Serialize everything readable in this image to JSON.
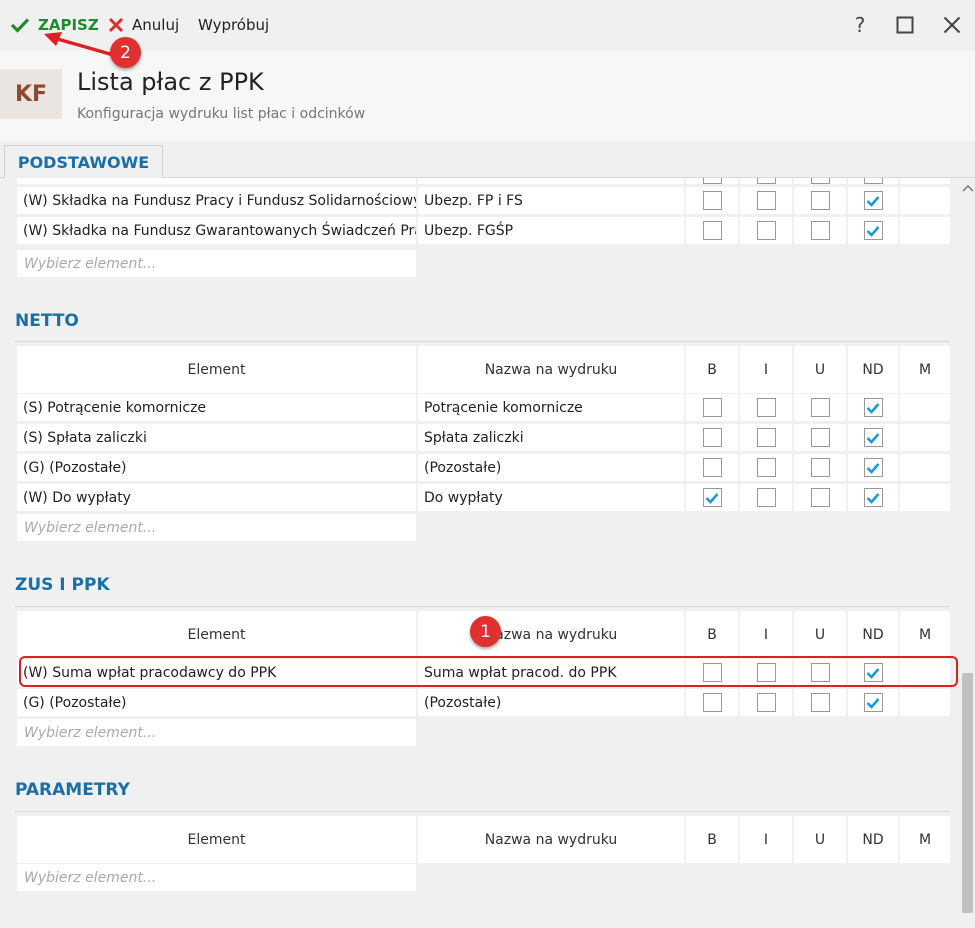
{
  "toolbar": {
    "save_label": "ZAPISZ",
    "cancel_label": "Anuluj",
    "try_label": "Wypróbuj",
    "help_label": "?"
  },
  "header": {
    "logo": "KF",
    "title": "Lista płac z PPK",
    "subtitle": "Konfiguracja wydruku list płac i odcinków"
  },
  "tabs": [
    {
      "label": "PODSTAWOWE",
      "active": true
    }
  ],
  "columns": {
    "element": "Element",
    "print_name": "Nazwa na wydruku",
    "b": "B",
    "i": "I",
    "u": "U",
    "nd": "ND",
    "m": "M"
  },
  "placeholder": "Wybierz element...",
  "section_podstawowe": {
    "rows": [
      {
        "element": "(W) Składka na Fundusz Pracy i Fundusz Solidarnościowy",
        "print_name": "Ubezp. FP i FS",
        "b": false,
        "i": false,
        "u": false,
        "nd": true
      },
      {
        "element": "(W) Składka na Fundusz Gwarantowanych Świadczeń Pracowniczych",
        "print_name": "Ubezp. FGŚP",
        "b": false,
        "i": false,
        "u": false,
        "nd": true
      }
    ]
  },
  "section_netto": {
    "title": "NETTO",
    "rows": [
      {
        "element": "(S) Potrącenie komornicze",
        "print_name": "Potrącenie komornicze",
        "b": false,
        "i": false,
        "u": false,
        "nd": true
      },
      {
        "element": "(S) Spłata zaliczki",
        "print_name": "Spłata zaliczki",
        "b": false,
        "i": false,
        "u": false,
        "nd": true
      },
      {
        "element": "(G) (Pozostałe)",
        "print_name": "(Pozostałe)",
        "b": false,
        "i": false,
        "u": false,
        "nd": true
      },
      {
        "element": "(W) Do wypłaty",
        "print_name": "Do wypłaty",
        "b": true,
        "i": false,
        "u": false,
        "nd": true
      }
    ]
  },
  "section_zus": {
    "title": "ZUS I PPK",
    "rows": [
      {
        "element": "(W) Suma wpłat pracodawcy do PPK",
        "print_name": "Suma wpłat pracod. do PPK",
        "b": false,
        "i": false,
        "u": false,
        "nd": true
      },
      {
        "element": "(G) (Pozostałe)",
        "print_name": "(Pozostałe)",
        "b": false,
        "i": false,
        "u": false,
        "nd": true
      }
    ]
  },
  "section_parametry": {
    "title": "PARAMETRY"
  },
  "annotations": {
    "badge_1": "1",
    "badge_2": "2"
  },
  "colors": {
    "accent": "#1b6fa8",
    "save_green": "#1f8a2c",
    "check_blue": "#1a9bd7",
    "annotation_red": "#e03030"
  }
}
